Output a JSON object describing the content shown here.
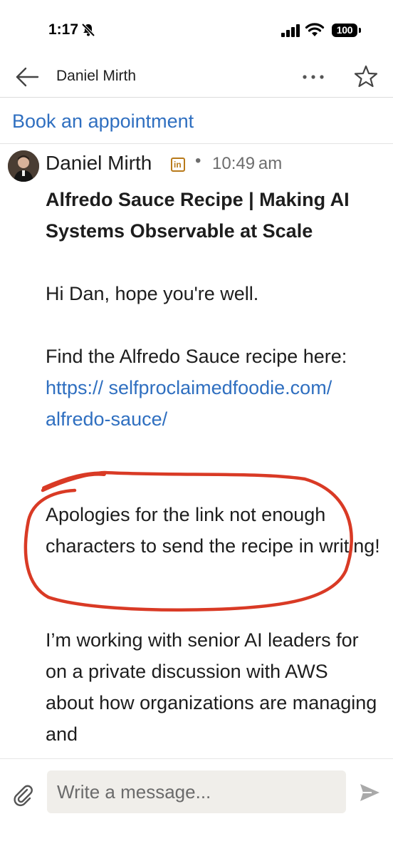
{
  "status_bar": {
    "time": "1:17",
    "battery": "100"
  },
  "header": {
    "contact_name": "Daniel Mirth"
  },
  "book_link": "Book an appointment",
  "message": {
    "sender": "Daniel Mirth",
    "badge": "in",
    "separator": "•",
    "timestamp": "10:49 am",
    "subject": "Alfredo Sauce Recipe | Making AI Systems Observable at Scale",
    "greeting": "Hi Dan, hope you're well.",
    "recipe_intro": "Find the Alfredo Sauce recipe here: ",
    "recipe_link": "https:// selfproclaimedfoodie.com/ alfredo-sauce/",
    "apology": "Apologies for the link not enough characters to send the recipe in writing!",
    "pitch": "I’m working with senior AI leaders for on a private discussion with AWS about how organizations are managing and"
  },
  "composer": {
    "placeholder": "Write a message..."
  },
  "colors": {
    "link": "#2f6fc0",
    "annotation": "#d93a25",
    "badge": "#b87a1a"
  },
  "icons": [
    "bell-slash-icon",
    "signal-icon",
    "wifi-icon",
    "battery-icon",
    "back-arrow-icon",
    "more-icon",
    "star-icon",
    "linkedin-badge-icon",
    "paperclip-icon",
    "send-icon"
  ]
}
